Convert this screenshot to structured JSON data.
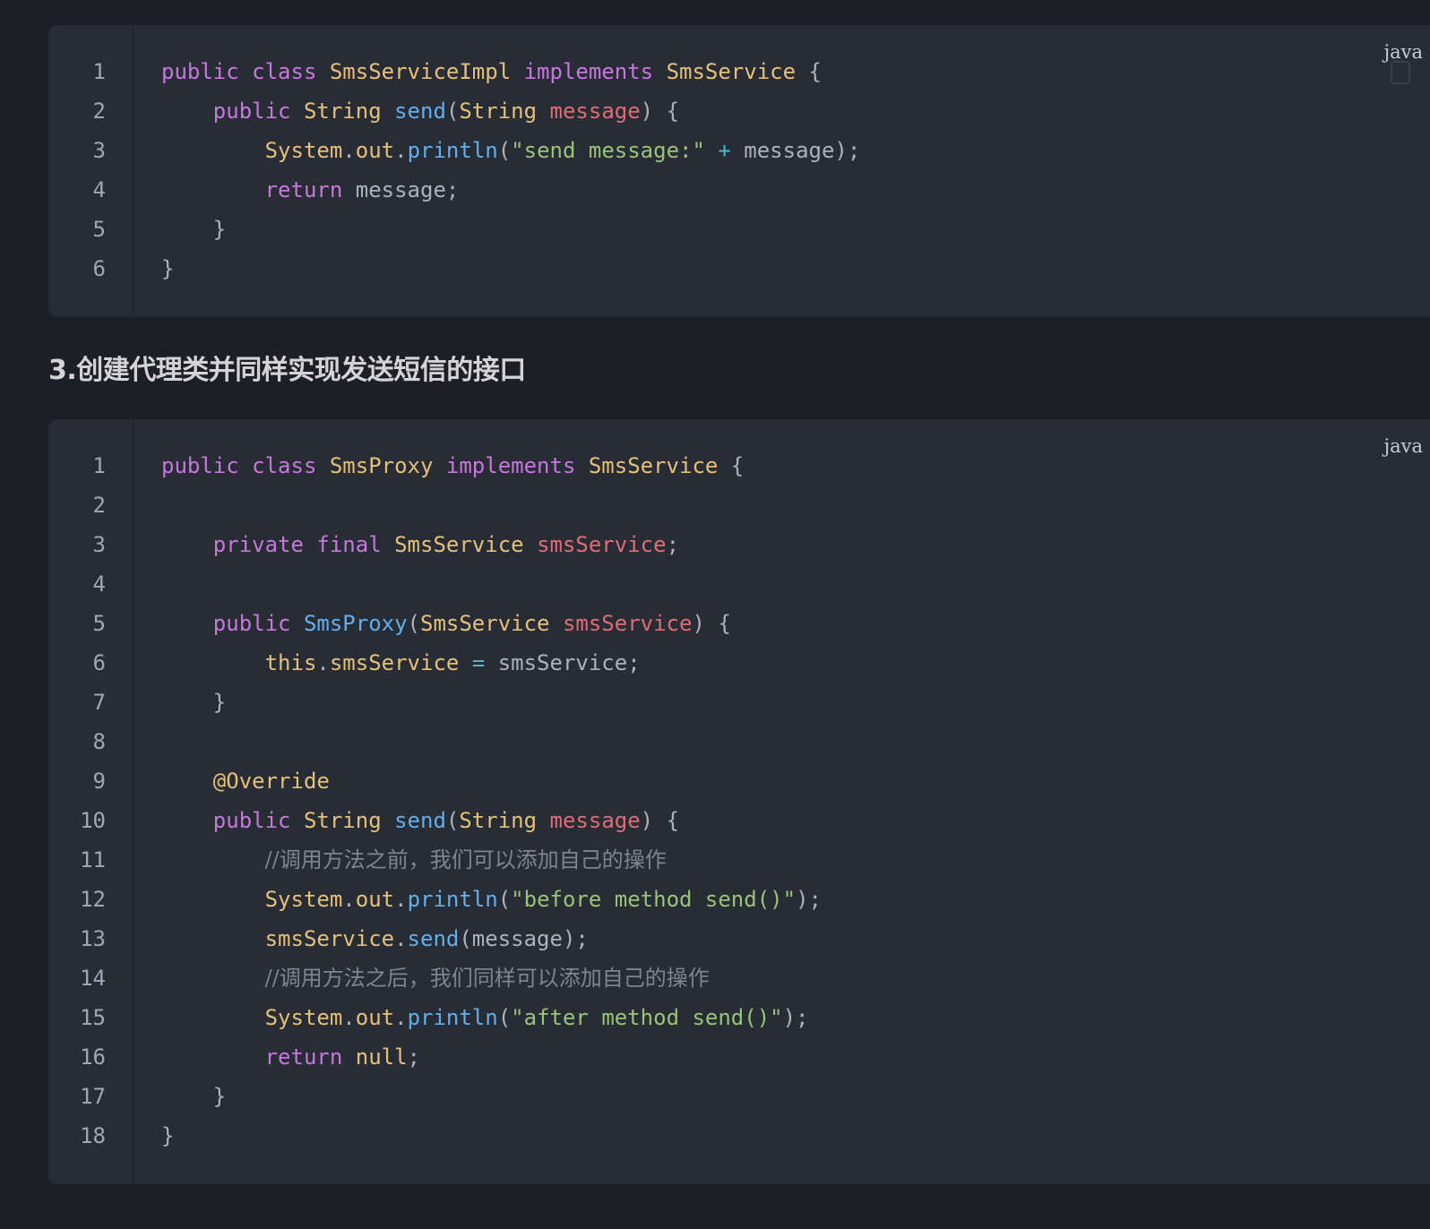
{
  "blocks": [
    {
      "language": "java",
      "lines": [
        [
          [
            "kw",
            "public"
          ],
          [
            "pl",
            " "
          ],
          [
            "kw",
            "class"
          ],
          [
            "pl",
            " "
          ],
          [
            "ty",
            "SmsServiceImpl"
          ],
          [
            "pl",
            " "
          ],
          [
            "kw",
            "implements"
          ],
          [
            "pl",
            " "
          ],
          [
            "ty",
            "SmsService"
          ],
          [
            "pl",
            " {"
          ]
        ],
        [
          [
            "pl",
            "    "
          ],
          [
            "kw",
            "public"
          ],
          [
            "pl",
            " "
          ],
          [
            "ty",
            "String"
          ],
          [
            "pl",
            " "
          ],
          [
            "fn",
            "send"
          ],
          [
            "pl",
            "("
          ],
          [
            "ty",
            "String"
          ],
          [
            "pl",
            " "
          ],
          [
            "pa",
            "message"
          ],
          [
            "pl",
            ") {"
          ]
        ],
        [
          [
            "pl",
            "        "
          ],
          [
            "ty",
            "System"
          ],
          [
            "pl",
            "."
          ],
          [
            "ty",
            "out"
          ],
          [
            "pl",
            "."
          ],
          [
            "fn",
            "println"
          ],
          [
            "pl",
            "("
          ],
          [
            "st",
            "\"send message:\""
          ],
          [
            "pl",
            " "
          ],
          [
            "op",
            "+"
          ],
          [
            "pl",
            " message);"
          ]
        ],
        [
          [
            "pl",
            "        "
          ],
          [
            "kw",
            "return"
          ],
          [
            "pl",
            " message;"
          ]
        ],
        [
          [
            "pl",
            "    }"
          ]
        ],
        [
          [
            "pl",
            "}"
          ]
        ]
      ]
    },
    {
      "language": "java",
      "lines": [
        [
          [
            "kw",
            "public"
          ],
          [
            "pl",
            " "
          ],
          [
            "kw",
            "class"
          ],
          [
            "pl",
            " "
          ],
          [
            "ty",
            "SmsProxy"
          ],
          [
            "pl",
            " "
          ],
          [
            "kw",
            "implements"
          ],
          [
            "pl",
            " "
          ],
          [
            "ty",
            "SmsService"
          ],
          [
            "pl",
            " {"
          ]
        ],
        [],
        [
          [
            "pl",
            "    "
          ],
          [
            "kw",
            "private"
          ],
          [
            "pl",
            " "
          ],
          [
            "kw",
            "final"
          ],
          [
            "pl",
            " "
          ],
          [
            "ty",
            "SmsService"
          ],
          [
            "pl",
            " "
          ],
          [
            "pa",
            "smsService"
          ],
          [
            "pl",
            ";"
          ]
        ],
        [],
        [
          [
            "pl",
            "    "
          ],
          [
            "kw",
            "public"
          ],
          [
            "pl",
            " "
          ],
          [
            "fn",
            "SmsProxy"
          ],
          [
            "pl",
            "("
          ],
          [
            "ty",
            "SmsService"
          ],
          [
            "pl",
            " "
          ],
          [
            "pa",
            "smsService"
          ],
          [
            "pl",
            ") {"
          ]
        ],
        [
          [
            "pl",
            "        "
          ],
          [
            "ty",
            "this"
          ],
          [
            "pl",
            "."
          ],
          [
            "ty",
            "smsService"
          ],
          [
            "pl",
            " "
          ],
          [
            "op",
            "="
          ],
          [
            "pl",
            " smsService;"
          ]
        ],
        [
          [
            "pl",
            "    }"
          ]
        ],
        [],
        [
          [
            "pl",
            "    "
          ],
          [
            "ty",
            "@Override"
          ]
        ],
        [
          [
            "pl",
            "    "
          ],
          [
            "kw",
            "public"
          ],
          [
            "pl",
            " "
          ],
          [
            "ty",
            "String"
          ],
          [
            "pl",
            " "
          ],
          [
            "fn",
            "send"
          ],
          [
            "pl",
            "("
          ],
          [
            "ty",
            "String"
          ],
          [
            "pl",
            " "
          ],
          [
            "pa",
            "message"
          ],
          [
            "pl",
            ") {"
          ]
        ],
        [
          [
            "pl",
            "        "
          ],
          [
            "cm",
            "//调用方法之前，我们可以添加自己的操作"
          ]
        ],
        [
          [
            "pl",
            "        "
          ],
          [
            "ty",
            "System"
          ],
          [
            "pl",
            "."
          ],
          [
            "ty",
            "out"
          ],
          [
            "pl",
            "."
          ],
          [
            "fn",
            "println"
          ],
          [
            "pl",
            "("
          ],
          [
            "st",
            "\"before method send()\""
          ],
          [
            "pl",
            ");"
          ]
        ],
        [
          [
            "pl",
            "        "
          ],
          [
            "ty",
            "smsService"
          ],
          [
            "pl",
            "."
          ],
          [
            "fn",
            "send"
          ],
          [
            "pl",
            "(message);"
          ]
        ],
        [
          [
            "pl",
            "        "
          ],
          [
            "cm",
            "//调用方法之后，我们同样可以添加自己的操作"
          ]
        ],
        [
          [
            "pl",
            "        "
          ],
          [
            "ty",
            "System"
          ],
          [
            "pl",
            "."
          ],
          [
            "ty",
            "out"
          ],
          [
            "pl",
            "."
          ],
          [
            "fn",
            "println"
          ],
          [
            "pl",
            "("
          ],
          [
            "st",
            "\"after method send()\""
          ],
          [
            "pl",
            ");"
          ]
        ],
        [
          [
            "pl",
            "        "
          ],
          [
            "kw",
            "return"
          ],
          [
            "pl",
            " "
          ],
          [
            "ty",
            "null"
          ],
          [
            "pl",
            ";"
          ]
        ],
        [
          [
            "pl",
            "    }"
          ]
        ],
        [
          [
            "pl",
            "}"
          ]
        ]
      ]
    }
  ],
  "heading": "3.创建代理类并同样实现发送短信的接口",
  "colors": {
    "keyword": "#c678dd",
    "type": "#e5c07b",
    "function": "#61afef",
    "parameter": "#e06c75",
    "string": "#98c379",
    "operator": "#56b6c2",
    "comment": "#7f848e",
    "plain": "#abb2bf",
    "background": "#282c34",
    "page": "#1e1f24"
  },
  "icons": {
    "copy": "copy-icon"
  }
}
